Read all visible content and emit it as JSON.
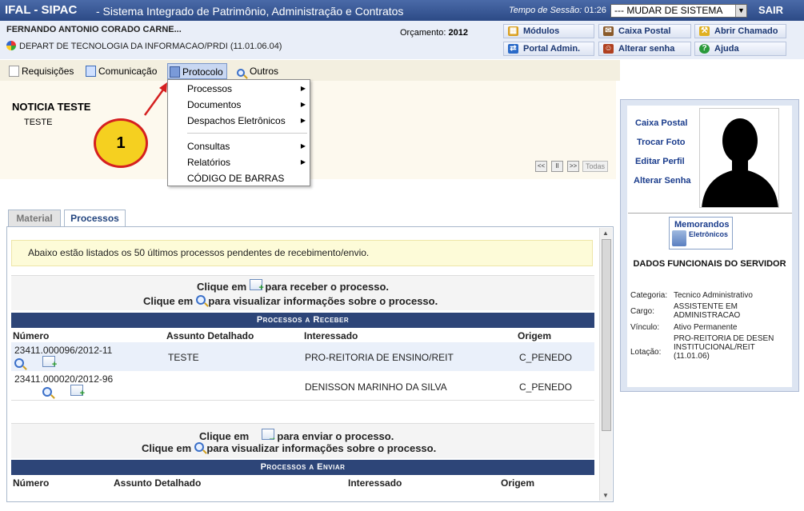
{
  "topbar": {
    "system_name": "IFAL - SIPAC",
    "system_full": "- Sistema Integrado de Patrimônio, Administração e Contratos",
    "session_label": "Tempo de Sessão:",
    "session_time": "01:26",
    "system_select": "--- MUDAR DE SISTEMA",
    "logout": "SAIR"
  },
  "user": {
    "name": "FERNANDO ANTONIO CORADO CARNE...",
    "department": "DEPART DE TECNOLOGIA DA INFORMACAO/PRDI (11.01.06.04)",
    "budget_label": "Orçamento:",
    "budget_year": "2012"
  },
  "quick_links": {
    "modulos": "Módulos",
    "caixa_postal": "Caixa Postal",
    "abrir_chamado": "Abrir Chamado",
    "portal_admin": "Portal Admin.",
    "alterar_senha": "Alterar senha",
    "ajuda": "Ajuda"
  },
  "menu": {
    "requisicoes": "Requisições",
    "comunicacao": "Comunicação",
    "protocolo": "Protocolo",
    "outros": "Outros"
  },
  "dropdown": {
    "processos": "Processos",
    "documentos": "Documentos",
    "despachos": "Despachos Eletrônicos",
    "consultas": "Consultas",
    "relatorios": "Relatórios",
    "codigo_barras": "CÓDIGO DE BARRAS"
  },
  "news": {
    "title": "NOTICIA TESTE",
    "text": "TESTE",
    "controls": [
      "<<",
      "II",
      ">>"
    ],
    "todas": "Todas"
  },
  "annotation": {
    "number": "1"
  },
  "tabs": {
    "material": "Material",
    "processos": "Processos"
  },
  "notice": "Abaixo estão listados os 50 últimos processos pendentes de recebimento/envio.",
  "receive": {
    "instr1_pre": "Clique em",
    "instr1_post": "para receber o processo.",
    "instr2_pre": "Clique em",
    "instr2_post": "para visualizar informações sobre o processo.",
    "header": "Processos a Receber",
    "columns": [
      "Número",
      "Assunto Detalhado",
      "Interessado",
      "Origem"
    ],
    "rows": [
      {
        "numero": "23411.000096/2012-11",
        "assunto": "TESTE",
        "interessado": "PRO-REITORIA DE ENSINO/REIT",
        "origem": "C_PENEDO"
      },
      {
        "numero": "23411.000020/2012-96",
        "assunto": "",
        "interessado": "DENISSON MARINHO DA SILVA",
        "origem": "C_PENEDO"
      }
    ]
  },
  "send": {
    "instr1_pre": "Clique em",
    "instr1_post": "para enviar o processo.",
    "instr2_pre": "Clique em",
    "instr2_post": "para visualizar informações sobre o processo.",
    "header": "Processos a Enviar",
    "columns": [
      "Número",
      "Assunto Detalhado",
      "Interessado",
      "Origem"
    ]
  },
  "profile": {
    "links": [
      "Caixa Postal",
      "Trocar Foto",
      "Editar Perfil",
      "Alterar Senha"
    ],
    "memo_line1": "Memorandos",
    "memo_line2": "Eletrônicos",
    "section_title": "DADOS FUNCIONAIS DO SERVIDOR",
    "categoria_label": "Categoria:",
    "categoria": "Tecnico Administrativo",
    "cargo_label": "Cargo:",
    "cargo": "ASSISTENTE EM ADMINISTRACAO",
    "vinculo_label": "Vínculo:",
    "vinculo": "Ativo Permanente",
    "lotacao_label": "Lotação:",
    "lotacao": "PRO-REITORIA DE DESEN INSTITUCIONAL/REIT (11.01.06)"
  },
  "colors": {
    "header_blue": "#2c4a86",
    "section_navy": "#2d4578",
    "annotation_yellow": "#f5d020",
    "annotation_red": "#d52020"
  }
}
